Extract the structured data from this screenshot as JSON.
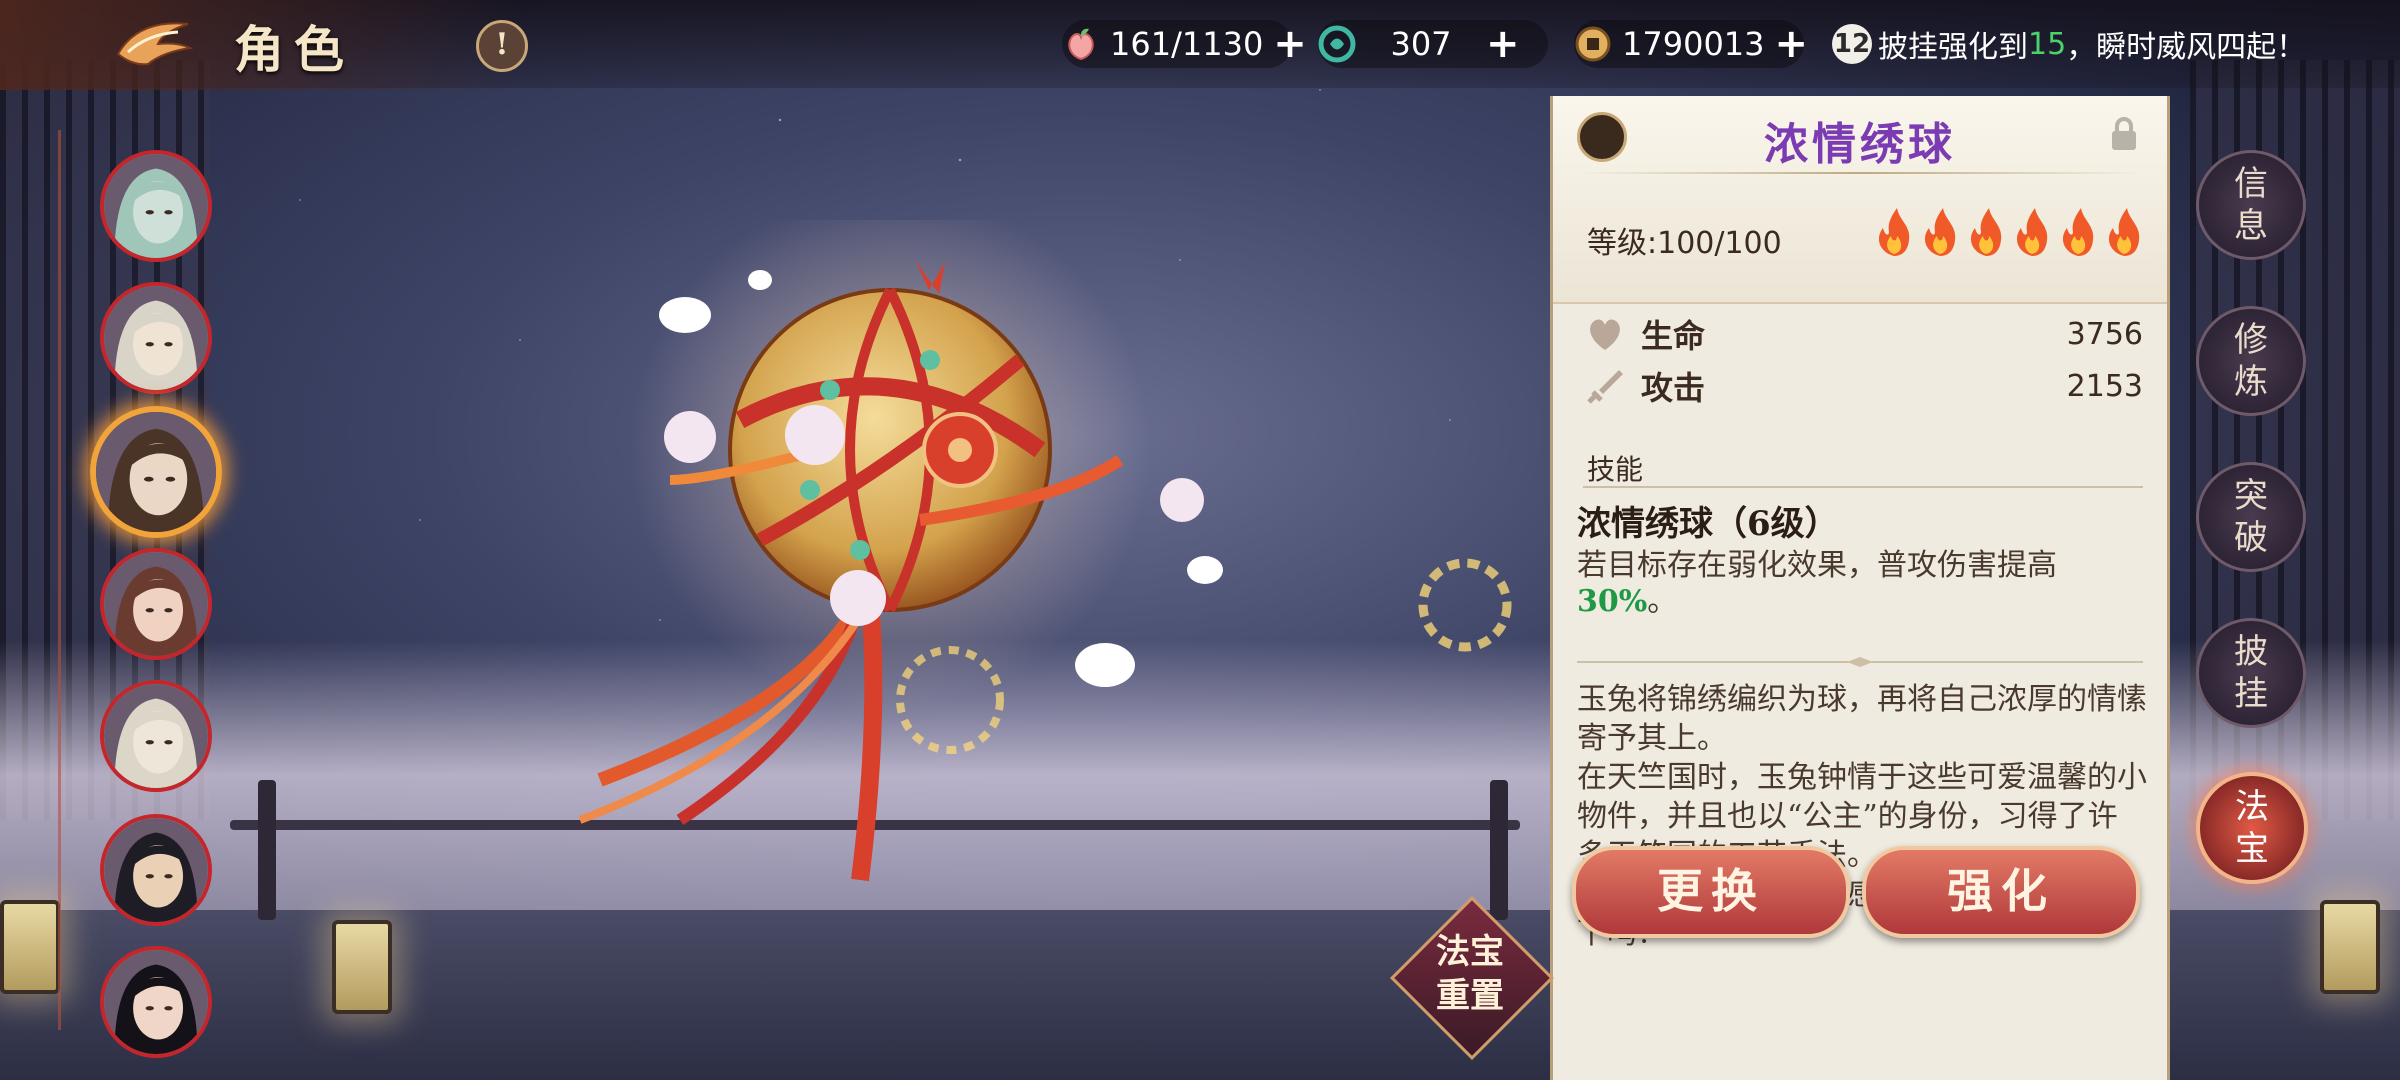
{
  "header": {
    "title": "角色",
    "info_symbol": "!"
  },
  "resources": [
    {
      "icon": "peach-icon",
      "value": "161/1130",
      "color": "#f2a0a0"
    },
    {
      "icon": "jade-coin-icon",
      "value": "307",
      "color": "#3fb7a2"
    },
    {
      "icon": "copper-coin-icon",
      "value": "1790013",
      "color": "#c8903c"
    }
  ],
  "tip": {
    "badge": "12",
    "prefix": "披挂强化到",
    "highlight": "15",
    "suffix": "，瞬时威风四起！"
  },
  "portraits": [
    {
      "name": "character-portrait-1",
      "skin": "#cfe0d8",
      "hair": "#9fc6b8"
    },
    {
      "name": "character-portrait-2",
      "skin": "#efe4d4",
      "hair": "#d9d4c8"
    },
    {
      "name": "character-portrait-3",
      "skin": "#ead7c6",
      "hair": "#4a3428",
      "active": true
    },
    {
      "name": "character-portrait-4",
      "skin": "#f0d2c2",
      "hair": "#6a3c30"
    },
    {
      "name": "character-portrait-5",
      "skin": "#eee6d8",
      "hair": "#dcd6c8"
    },
    {
      "name": "character-portrait-6",
      "skin": "#ead0b4",
      "hair": "#1e1c24"
    },
    {
      "name": "character-portrait-7",
      "skin": "#f0d6c6",
      "hair": "#141218"
    }
  ],
  "treasure": {
    "name": "浓情绣球",
    "level_label": "等级:100/100",
    "stars": 6,
    "stats": [
      {
        "icon": "heart-icon",
        "label": "生命",
        "value": "3756"
      },
      {
        "icon": "sword-icon",
        "label": "攻击",
        "value": "2153"
      }
    ],
    "skill_section": "技能",
    "skill_name": "浓情绣球（6级）",
    "skill_desc": "若目标存在弱化效果，普攻伤害提高",
    "skill_pct": "30%",
    "skill_end": "。",
    "lore": "玉兔将锦绣编织为球，再将自己浓厚的情愫寄予其上。\n在天竺国时，玉兔钟情于这些可爱温馨的小物件，并且也以“公主”的身份，习得了许多天竺国的工艺手法。\n这份过于“热烈”的情感，你有把握尽数接下吗？"
  },
  "actions": {
    "replace": "更换",
    "enhance": "强化",
    "reset_line1": "法宝",
    "reset_line2": "重置"
  },
  "side_tabs": [
    {
      "name": "tab-info",
      "label": "信息"
    },
    {
      "name": "tab-cultivate",
      "label": "修炼"
    },
    {
      "name": "tab-breakthrough",
      "label": "突破"
    },
    {
      "name": "tab-armor",
      "label": "披挂"
    },
    {
      "name": "tab-treasure",
      "label": "法宝",
      "active": true
    }
  ]
}
